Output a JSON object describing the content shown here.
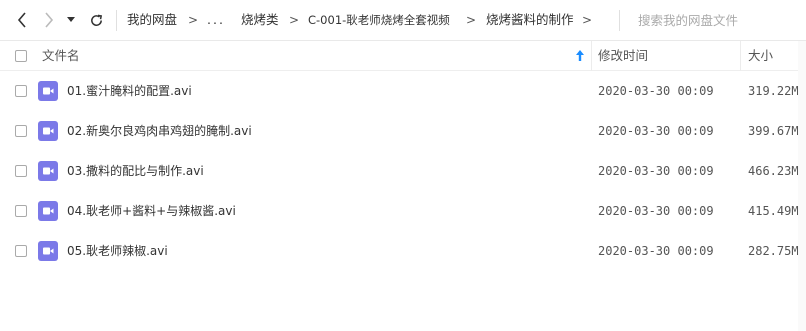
{
  "breadcrumb": {
    "items": [
      "我的网盘",
      "...",
      "烧烤类",
      "C-001-耿老师烧烤全套视频",
      "烧烤酱料的制作"
    ],
    "separator": ">"
  },
  "search": {
    "placeholder": "搜索我的网盘文件"
  },
  "table": {
    "columns": {
      "name": "文件名",
      "modified": "修改时间",
      "size": "大小"
    },
    "sort": {
      "column": "name",
      "direction": "ascending"
    },
    "rows": [
      {
        "name": "01.蜜汁腌料的配置.avi",
        "modified": "2020-03-30 00:09",
        "size": "319.22MB"
      },
      {
        "name": "02.新奥尔良鸡肉串鸡翅的腌制.avi",
        "modified": "2020-03-30 00:09",
        "size": "399.67MB"
      },
      {
        "name": "03.撒料的配比与制作.avi",
        "modified": "2020-03-30 00:09",
        "size": "466.23MB"
      },
      {
        "name": "04.耿老师+酱料+与辣椒酱.avi",
        "modified": "2020-03-30 00:09",
        "size": "415.49MB"
      },
      {
        "name": "05.耿老师辣椒.avi",
        "modified": "2020-03-30 00:09",
        "size": "282.75MB"
      }
    ]
  },
  "colors": {
    "file_icon": "#7b79e8",
    "sort_arrow": "#1a8cff"
  },
  "icons": {
    "back": "chevron-left-icon",
    "forward": "chevron-right-icon",
    "history": "caret-down-icon",
    "refresh": "refresh-icon",
    "sort": "arrow-up-icon",
    "file": "video-file-icon"
  }
}
